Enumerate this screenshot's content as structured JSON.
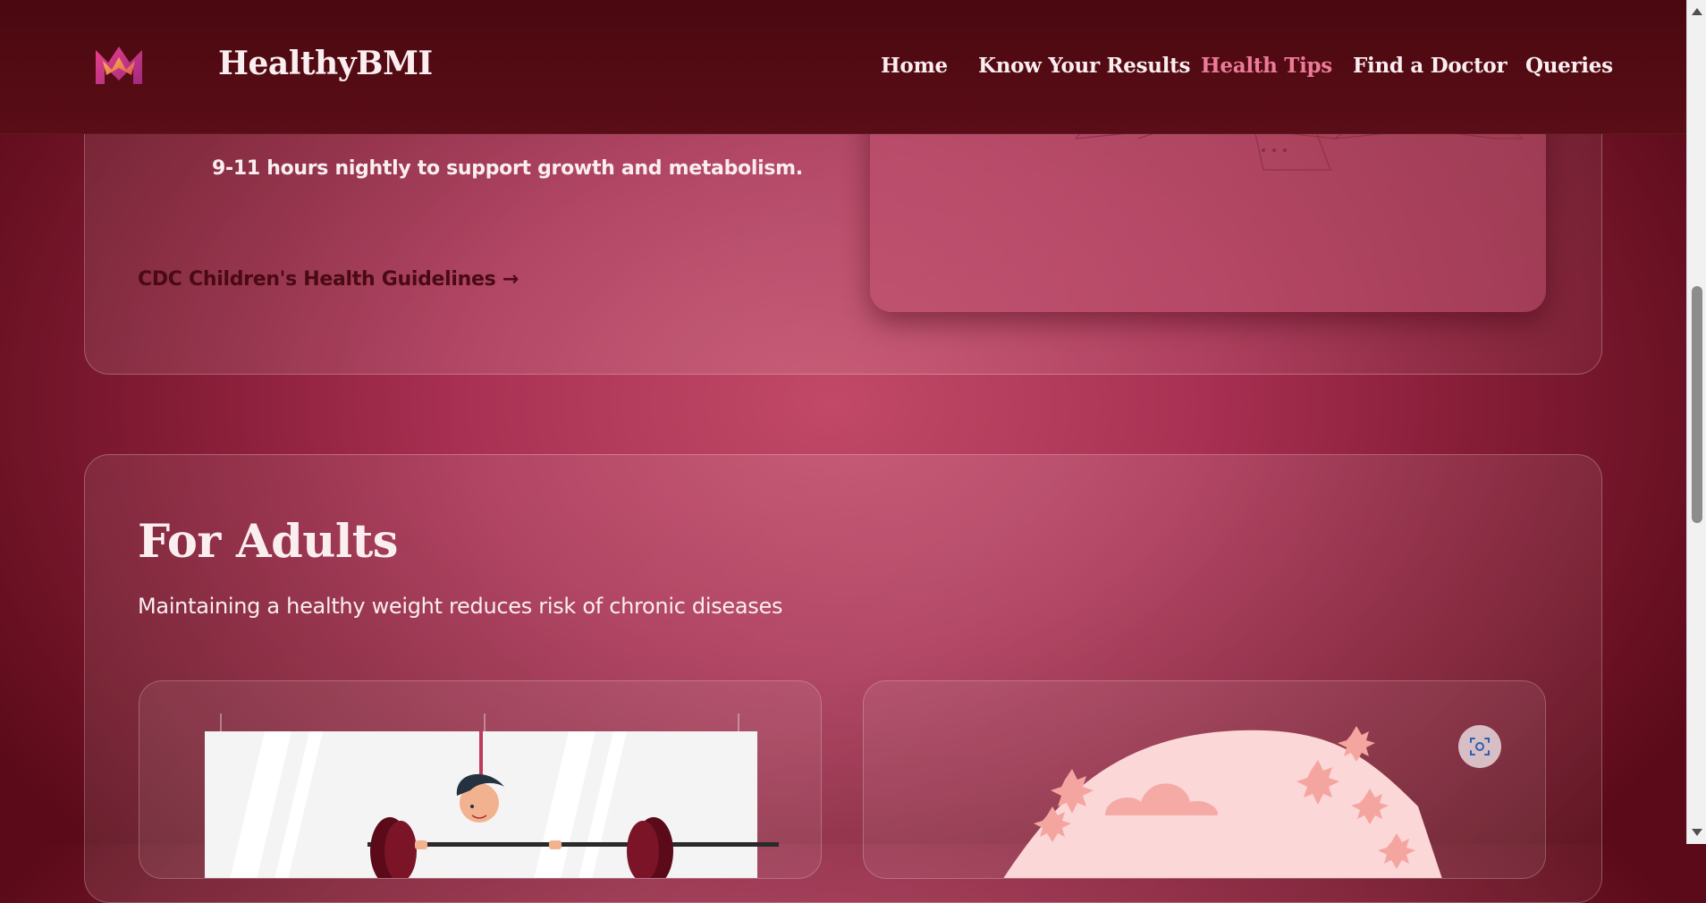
{
  "brand": {
    "name": "HealthyBMI",
    "logo_icon": "m-monogram-logo-icon"
  },
  "nav": {
    "items": [
      {
        "label": "Home",
        "active": false
      },
      {
        "label": "Know Your Results",
        "active": false
      },
      {
        "label": "Health Tips",
        "active": true
      },
      {
        "label": "Find a Doctor",
        "active": false
      },
      {
        "label": "Queries",
        "active": false
      }
    ]
  },
  "children_section": {
    "sleep_text": "9-11 hours nightly to support growth and metabolism.",
    "link_label": "CDC Children's Health Guidelines →"
  },
  "adults_section": {
    "title": "For Adults",
    "subtitle": "Maintaining a healthy weight reduces risk of chronic diseases"
  },
  "colors": {
    "header_bg": "#4a0810",
    "accent_active": "#ec7b98",
    "text_light": "#fbeef0",
    "link_dark": "#4a0a14"
  },
  "icons": {
    "scan": "scan-screen-icon",
    "scroll_up": "scroll-up-arrow-icon",
    "scroll_down": "scroll-down-arrow-icon"
  }
}
